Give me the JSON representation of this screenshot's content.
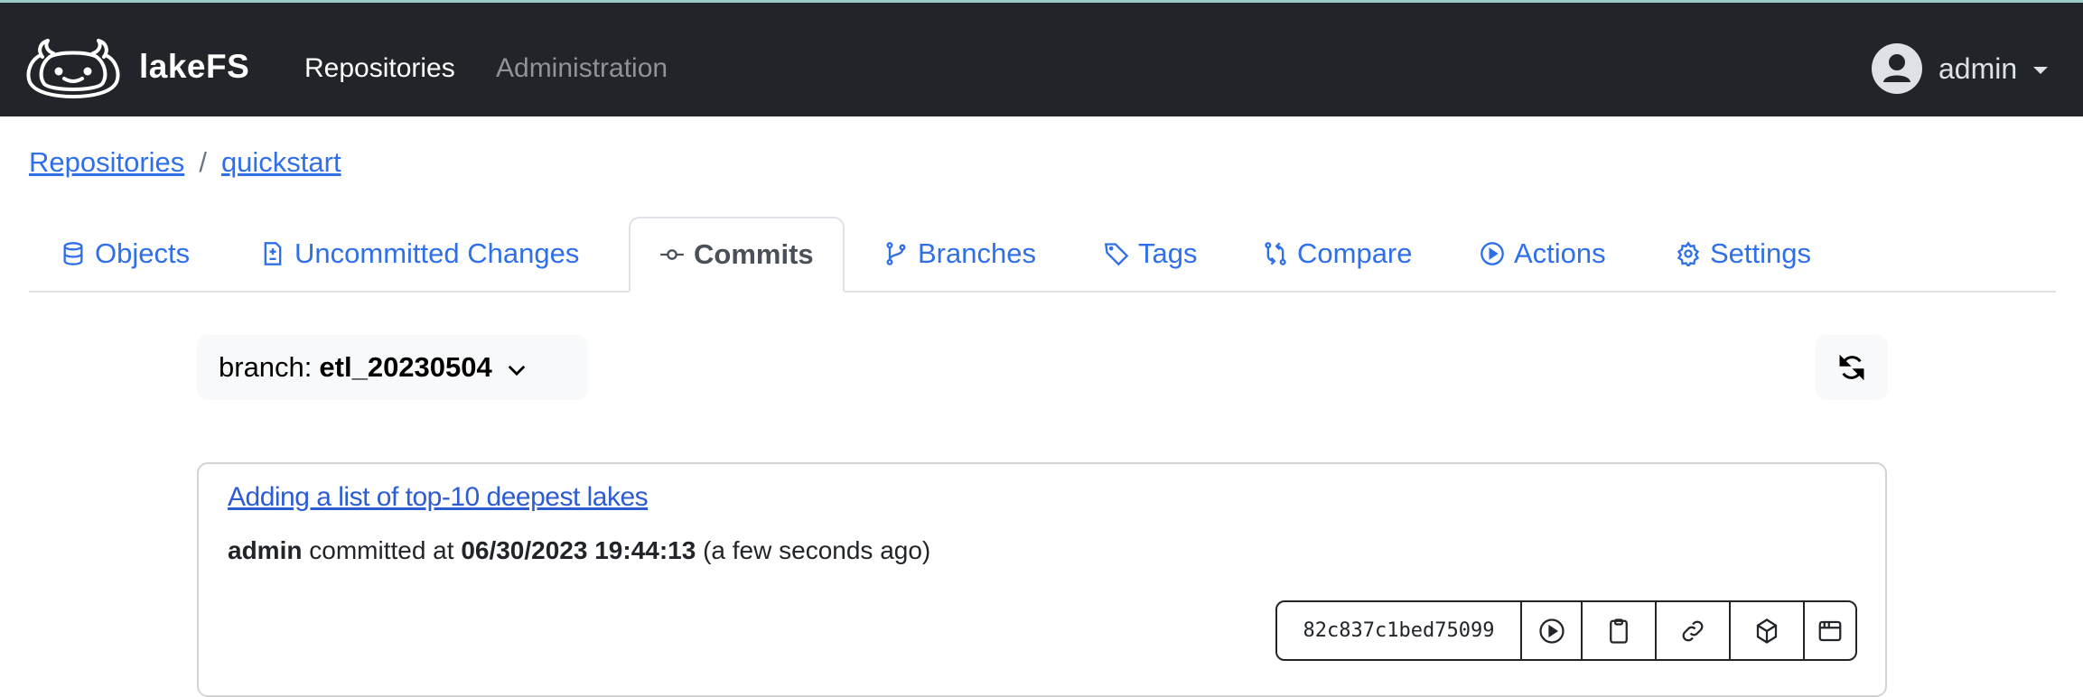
{
  "navbar": {
    "brand": "lakeFS",
    "links": [
      {
        "label": "Repositories",
        "active": true
      },
      {
        "label": "Administration",
        "active": false
      }
    ],
    "user": {
      "name": "admin"
    }
  },
  "breadcrumb": {
    "items": [
      "Repositories",
      "quickstart"
    ],
    "separator": "/"
  },
  "tabs": [
    {
      "label": "Objects",
      "icon": "database-icon",
      "active": false
    },
    {
      "label": "Uncommitted Changes",
      "icon": "file-diff-icon",
      "active": false
    },
    {
      "label": "Commits",
      "icon": "git-commit-icon",
      "active": true
    },
    {
      "label": "Branches",
      "icon": "git-branch-icon",
      "active": false
    },
    {
      "label": "Tags",
      "icon": "tag-icon",
      "active": false
    },
    {
      "label": "Compare",
      "icon": "git-compare-icon",
      "active": false
    },
    {
      "label": "Actions",
      "icon": "play-circle-icon",
      "active": false
    },
    {
      "label": "Settings",
      "icon": "gear-icon",
      "active": false
    }
  ],
  "branch_selector": {
    "label": "branch:",
    "value": "etl_20230504"
  },
  "commits": [
    {
      "message": "Adding a list of top-10 deepest lakes",
      "committer": "admin",
      "committed_at_label": "committed at",
      "timestamp": "06/30/2023 19:44:13",
      "relative": "(a few seconds ago)",
      "id": "82c837c1bed75099",
      "actions": [
        "play-circle-icon",
        "clipboard-icon",
        "link-icon",
        "package-icon",
        "browser-icon"
      ]
    }
  ],
  "colors": {
    "navbar_bg": "#212529",
    "link": "#2f6fe8",
    "active_tab_text": "#495057",
    "commit_link": "#2d5bd1"
  }
}
